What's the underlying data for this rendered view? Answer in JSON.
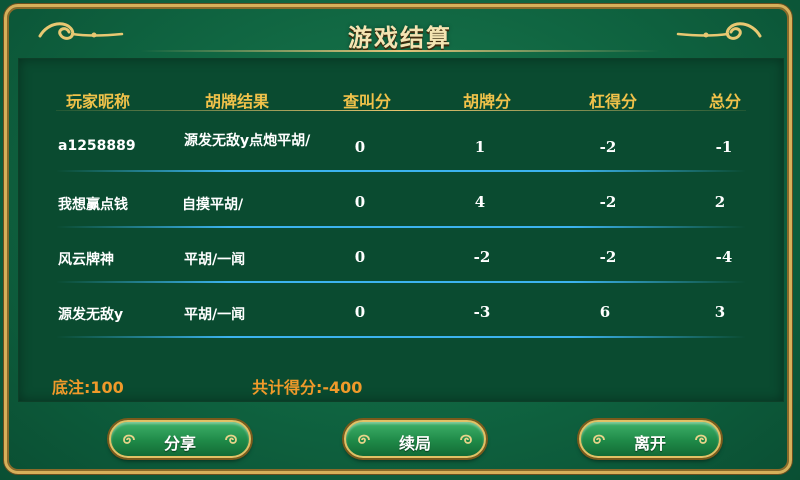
{
  "title": "游戏结算",
  "columns": [
    "玩家昵称",
    "胡牌结果",
    "查叫分",
    "胡牌分",
    "杠得分",
    "总分"
  ],
  "rows": [
    {
      "name": "a1258889",
      "result": "源发无敌y点炮平胡/",
      "cha": "0",
      "hu": "1",
      "gang": "-2",
      "total": "-1"
    },
    {
      "name": "我想赢点钱",
      "result": "自摸平胡/",
      "cha": "0",
      "hu": "4",
      "gang": "-2",
      "total": "2"
    },
    {
      "name": "风云牌神",
      "result": "平胡/一闻",
      "cha": "0",
      "hu": "-2",
      "gang": "-2",
      "total": "-4"
    },
    {
      "name": "源发无敌y",
      "result": "平胡/一闻",
      "cha": "0",
      "hu": "-3",
      "gang": "6",
      "total": "3"
    }
  ],
  "footer": {
    "base_bet": "底注:100",
    "total_score": "共计得分:-400"
  },
  "buttons": {
    "share": "分享",
    "continue": "续局",
    "leave": "离开"
  },
  "colors": {
    "header": "#f0c24a",
    "footer": "#f09a2a",
    "row_separator": "#3cb3ee",
    "frame": "#d7b05a"
  }
}
